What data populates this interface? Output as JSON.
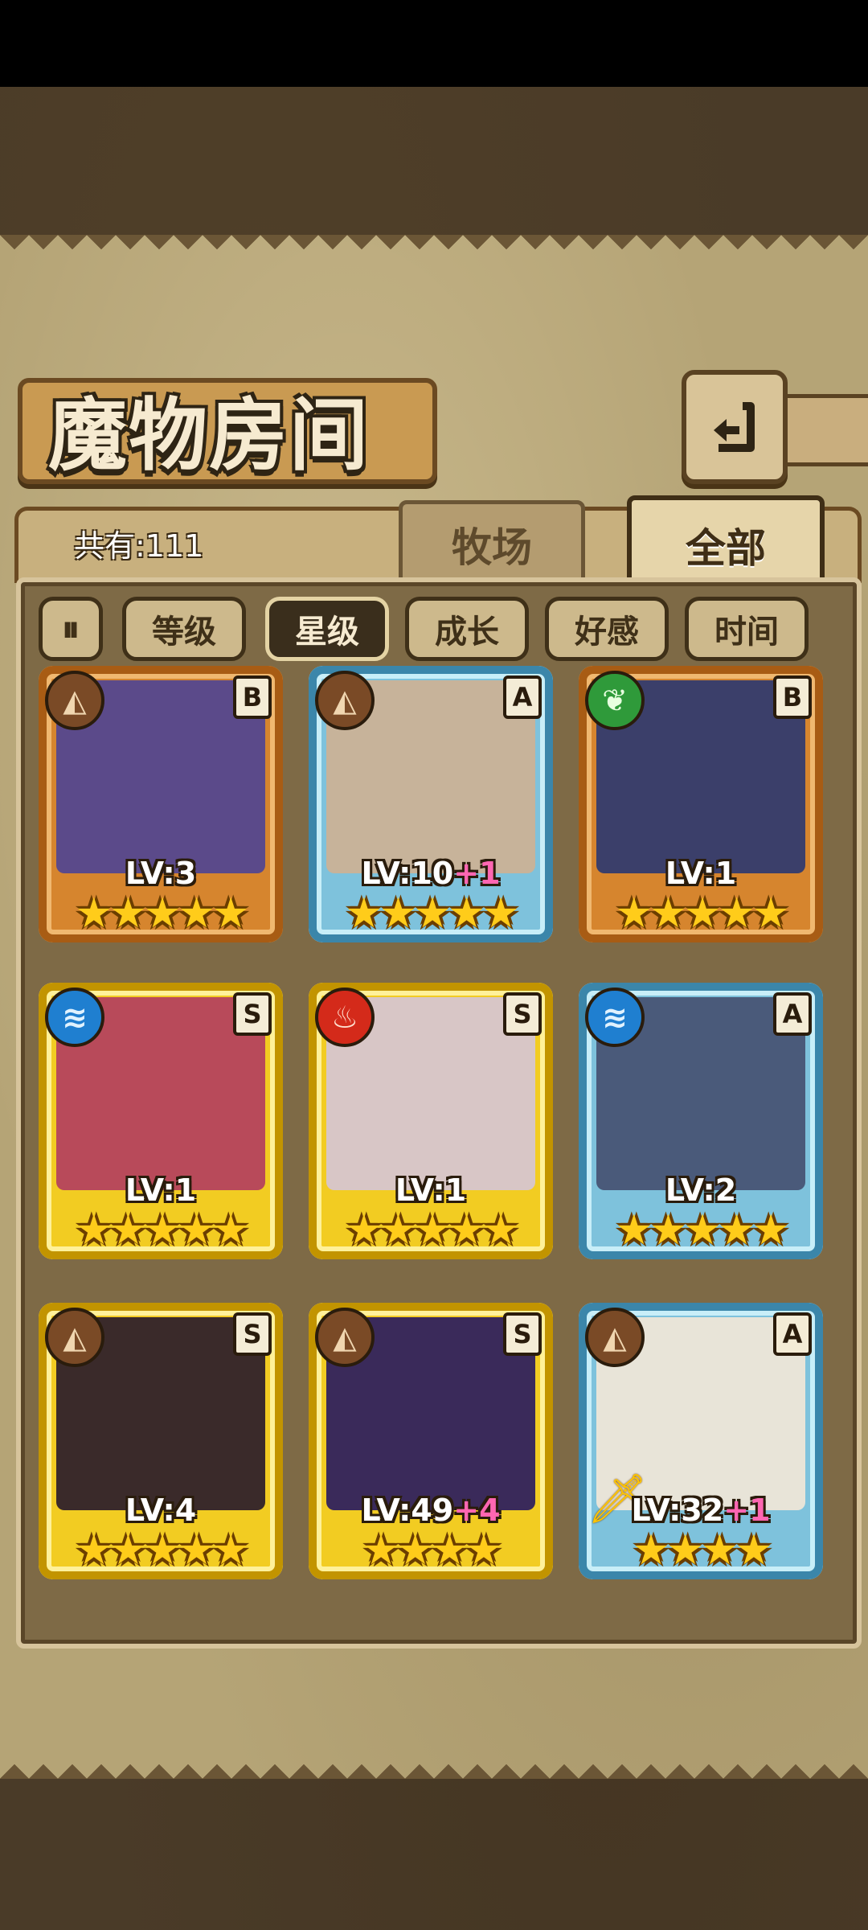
{
  "page": {
    "title": "魔物房间",
    "count_label": "共有:111"
  },
  "tabs": [
    {
      "label": "牧场",
      "active": false
    },
    {
      "label": "全部",
      "active": true
    }
  ],
  "filters": {
    "sort_icon": "pause-sort-icon",
    "items": [
      {
        "label": "等级",
        "active": false
      },
      {
        "label": "星级",
        "active": true
      },
      {
        "label": "成长",
        "active": false
      },
      {
        "label": "好感",
        "active": false
      },
      {
        "label": "时间",
        "active": false
      }
    ]
  },
  "monsters": [
    {
      "element": "earth",
      "element_glyph": "◭",
      "rank": "B",
      "level": "LV:3",
      "bonus": "",
      "stars": "★★★★★",
      "frame": "bronze"
    },
    {
      "element": "earth",
      "element_glyph": "◭",
      "rank": "A",
      "level": "LV:10",
      "bonus": "+1",
      "stars": "★★★★★",
      "frame": "blue"
    },
    {
      "element": "leaf",
      "element_glyph": "❦",
      "rank": "B",
      "level": "LV:1",
      "bonus": "",
      "stars": "★★★★★",
      "frame": "bronze"
    },
    {
      "element": "water",
      "element_glyph": "≋",
      "rank": "S",
      "level": "LV:1",
      "bonus": "",
      "stars": "★★★★★",
      "frame": "gold"
    },
    {
      "element": "fire",
      "element_glyph": "♨",
      "rank": "S",
      "level": "LV:1",
      "bonus": "",
      "stars": "★★★★★",
      "frame": "gold"
    },
    {
      "element": "water",
      "element_glyph": "≋",
      "rank": "A",
      "level": "LV:2",
      "bonus": "",
      "stars": "★★★★★",
      "frame": "blue"
    },
    {
      "element": "earth",
      "element_glyph": "◭",
      "rank": "S",
      "level": "LV:4",
      "bonus": "",
      "stars": "★★★★★",
      "frame": "gold"
    },
    {
      "element": "earth",
      "element_glyph": "◭",
      "rank": "S",
      "level": "LV:49",
      "bonus": "+4",
      "stars": "★★★★",
      "frame": "gold"
    },
    {
      "element": "earth",
      "element_glyph": "◭",
      "rank": "A",
      "level": "LV:32",
      "bonus": "+1",
      "stars": "★★★★",
      "frame": "blue"
    }
  ],
  "colors": {
    "element_earth": "#7a4a26",
    "element_leaf": "#2f9a3a",
    "element_water": "#1f7fd0",
    "element_fire": "#d42a1a",
    "portrait_0": "#5b4a8a",
    "portrait_1": "#c7b39a",
    "portrait_2": "#3b3f6a",
    "portrait_3": "#b84a5a",
    "portrait_4": "#d8c6c6",
    "portrait_5": "#4a5a7a",
    "portrait_6": "#3a2a2a",
    "portrait_7": "#3a2a5a",
    "portrait_8": "#e8e4d8"
  }
}
